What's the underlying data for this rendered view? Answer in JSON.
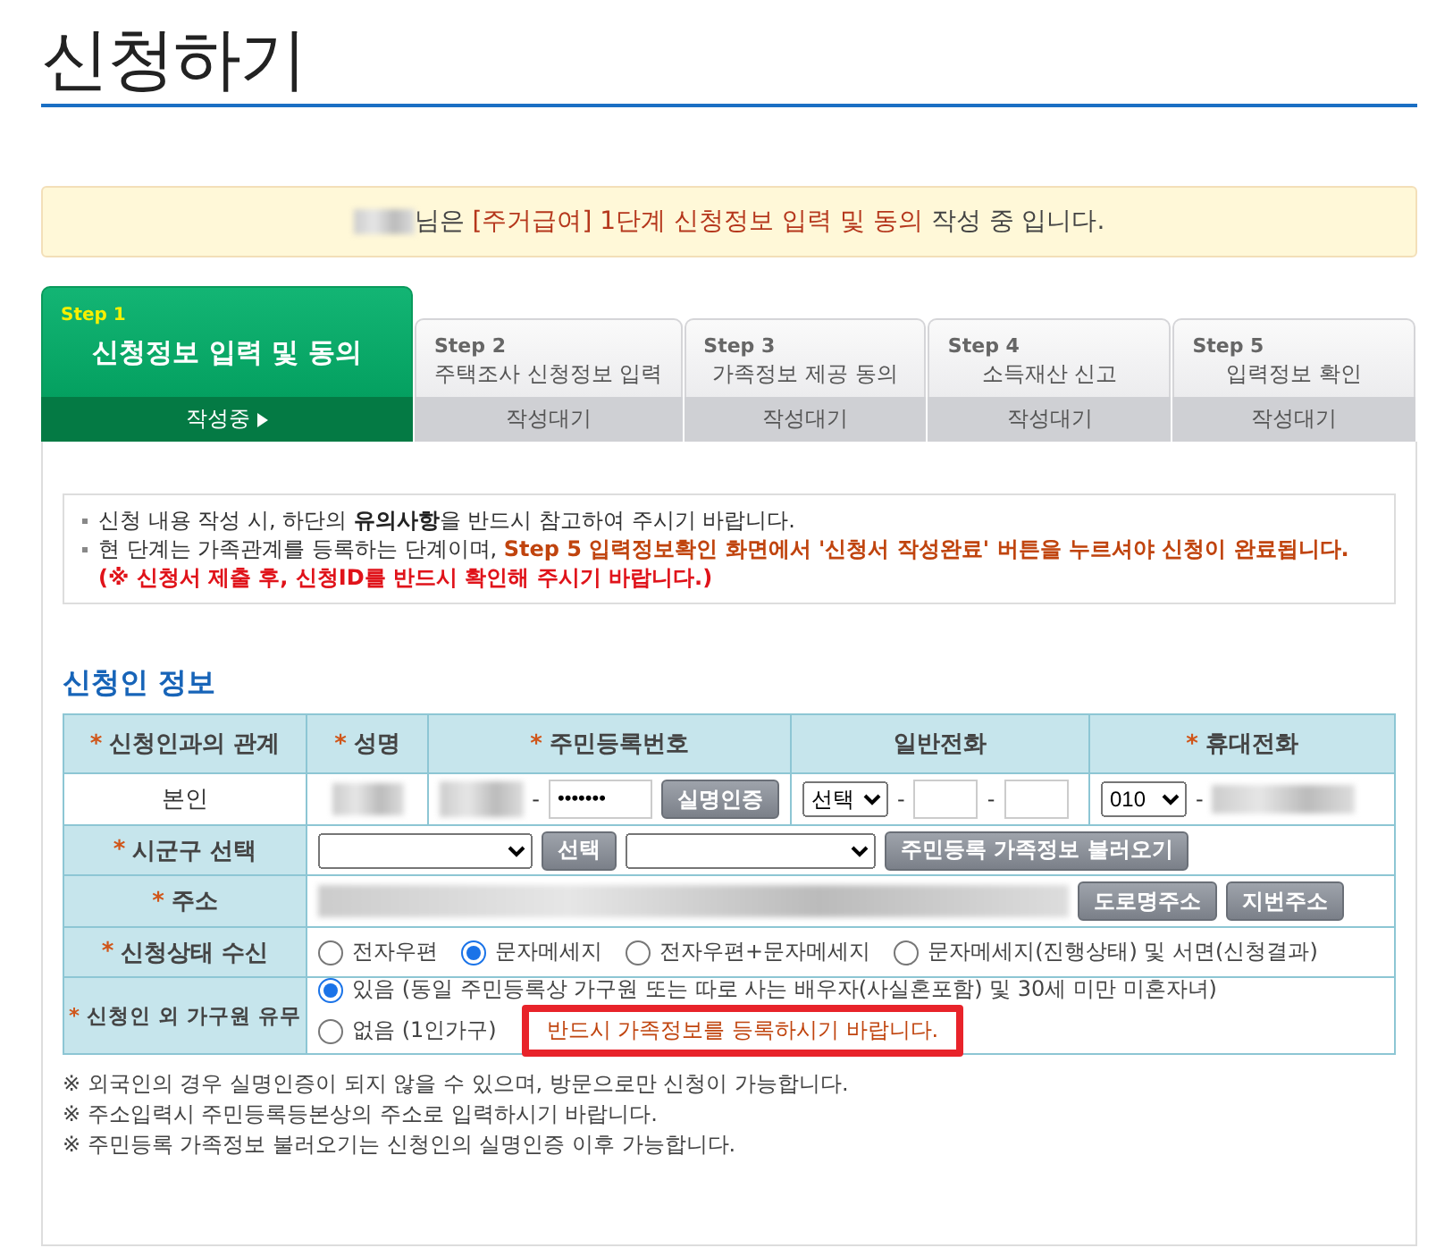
{
  "page_title": "신청하기",
  "notice": {
    "lead": "님은",
    "highlight": "[주거급여] 1단계 신청정보 입력 및 동의",
    "tail": "작성 중 입니다."
  },
  "steps": [
    {
      "step": "Step 1",
      "title": "신청정보 입력 및 동의",
      "status": "작성중",
      "selected": true
    },
    {
      "step": "Step 2",
      "title": "주택조사 신청정보 입력",
      "status": "작성대기",
      "selected": false
    },
    {
      "step": "Step 3",
      "title": "가족정보 제공 동의",
      "status": "작성대기",
      "selected": false
    },
    {
      "step": "Step 4",
      "title": "소득재산 신고",
      "status": "작성대기",
      "selected": false
    },
    {
      "step": "Step 5",
      "title": "입력정보 확인",
      "status": "작성대기",
      "selected": false
    }
  ],
  "guide": [
    {
      "text": "신청 내용 작성 시, 하단의 **유의사항**을 반드시 참고하여 주시기 바랍니다."
    },
    {
      "text": "현 단계는 가족관계를 등록하는 단계이며, ",
      "emphasis": "Step 5 입력정보확인 화면에서 '신청서 작성완료' 버튼을 누르셔야 신청이 완료됩니다.",
      "warning": "(※ 신청서 제출 후, 신청ID를 반드시 확인해 주시기 바랍니다.)"
    }
  ],
  "section_title": "신청인 정보",
  "table": {
    "columns": [
      {
        "label": "신청인과의 관계",
        "marker": "*"
      },
      {
        "label": "성명",
        "marker": "*"
      },
      {
        "label": "주민등록번호",
        "marker": "*"
      },
      {
        "label": "일반전화"
      },
      {
        "label": "휴대전화",
        "marker": "*"
      }
    ],
    "applicant": {
      "relation": "본인",
      "rrn_separator": "-",
      "rrn_back": "•••••••",
      "verify_button": "실명인증",
      "phone_area": "선택",
      "phone_separators": [
        "-",
        "-"
      ],
      "mobile_prefix": "010",
      "mobile_separator": "-"
    },
    "region": {
      "label": "시군구 선택",
      "marker": "*",
      "select_button": "선택",
      "load_button": "주민등록 가족정보 불러오기"
    },
    "address": {
      "label": "주소",
      "marker": "*",
      "buttons": [
        "도로명주소",
        "지번주소"
      ]
    },
    "receive": {
      "label": "신청상태  수신",
      "marker": "*",
      "options": [
        {
          "label": "전자우편",
          "selected": false
        },
        {
          "label": "문자메세지",
          "selected": true
        },
        {
          "label": "전자우편+문자메세지",
          "selected": false
        },
        {
          "label": "문자메세지(진행상태) 및 서면(신청결과)",
          "selected": false
        }
      ]
    },
    "household": {
      "label": "신청인 외 가구원 유무",
      "marker": "*",
      "options": [
        {
          "label": "있음 (동일 주민등록상 가구원 또는 따로 사는 배우자(사실혼포함) 및 30세 미만 미혼자녀)",
          "selected": true
        },
        {
          "label": "없음 (1인가구)",
          "selected": false
        }
      ],
      "callout": "반드시 가족정보를 등록하시기 바랍니다."
    }
  },
  "notes": [
    "※ 외국인의 경우 실명인증이 되지 않을 수 있으며, 방문으로만 신청이 가능합니다.",
    "※ 주소입력시 주민등록등본상의 주소로 입력하시기 바랍니다.",
    "※ 주민등록 가족정보 불러오기는 신청인의 실명인증 이후 가능합니다."
  ]
}
